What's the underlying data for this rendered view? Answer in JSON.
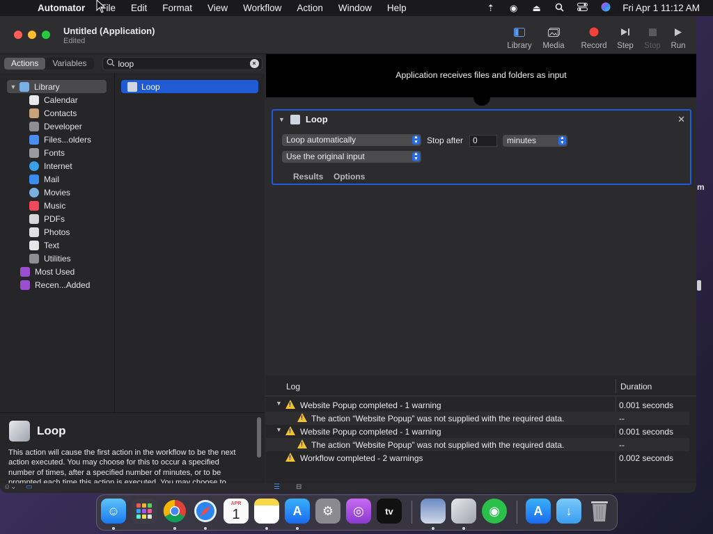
{
  "menubar": {
    "app_name": "Automator",
    "items": [
      "File",
      "Edit",
      "Format",
      "View",
      "Workflow",
      "Action",
      "Window",
      "Help"
    ],
    "clock": "Fri Apr 1  11:12 AM",
    "status_icons": [
      "wifi-icon",
      "user-icon",
      "eject-icon",
      "search-icon",
      "control-center-icon",
      "siri-icon"
    ]
  },
  "window": {
    "title": "Untitled (Application)",
    "subtitle": "Edited"
  },
  "toolbar": {
    "library": "Library",
    "media": "Media",
    "record": "Record",
    "step": "Step",
    "stop": "Stop",
    "run": "Run"
  },
  "left_tabs": {
    "actions": "Actions",
    "variables": "Variables"
  },
  "search": {
    "value": "loop"
  },
  "library": {
    "root": "Library",
    "items": [
      {
        "label": "Calendar",
        "color": "#e9e9e9"
      },
      {
        "label": "Contacts",
        "color": "#c8a27a"
      },
      {
        "label": "Developer",
        "color": "#8e8e93"
      },
      {
        "label": "Files...olders",
        "color": "#4a8df0"
      },
      {
        "label": "Fonts",
        "color": "#9a9aa0"
      },
      {
        "label": "Internet",
        "color": "#3aa0e8"
      },
      {
        "label": "Mail",
        "color": "#3a8cf0"
      },
      {
        "label": "Movies",
        "color": "#7ab0e0"
      },
      {
        "label": "Music",
        "color": "#f04a5a"
      },
      {
        "label": "PDFs",
        "color": "#d8d8d8"
      },
      {
        "label": "Photos",
        "color": "#e0e0e0"
      },
      {
        "label": "Text",
        "color": "#e6e6e6"
      },
      {
        "label": "Utilities",
        "color": "#8e8e93"
      }
    ],
    "smart_groups": [
      {
        "label": "Most Used",
        "color": "#9a4fd0"
      },
      {
        "label": "Recen...Added",
        "color": "#9a4fd0"
      }
    ]
  },
  "actions_list": {
    "items": [
      "Loop"
    ]
  },
  "description": {
    "title": "Loop",
    "text": "This action will cause the first action in the workflow to be the next action executed. You may choose for this to occur a specified number of times, after a specified number of minutes, or to be prompted each time this action is executed.  You may choose to restart the workflow with the original set of data or to"
  },
  "workflow": {
    "header": "Application receives files and folders as input",
    "card": {
      "title": "Loop",
      "loop_mode": "Loop automatically",
      "stop_after_label": "Stop after",
      "stop_after_value": "0",
      "unit": "minutes",
      "input_mode": "Use the original input",
      "tab_results": "Results",
      "tab_options": "Options"
    }
  },
  "log": {
    "col_log": "Log",
    "col_duration": "Duration",
    "rows": [
      {
        "text": "Website Popup completed - 1 warning",
        "duration": "0.001 seconds"
      },
      {
        "text": "The action “Website Popup” was not supplied with the required data.",
        "duration": "--"
      },
      {
        "text": "Website Popup completed - 1 warning",
        "duration": "0.001 seconds"
      },
      {
        "text": "The action “Website Popup” was not supplied with the required data.",
        "duration": "--"
      },
      {
        "text": "Workflow completed - 2 warnings",
        "duration": "0.002 seconds"
      }
    ]
  },
  "background": {
    "partial_text": "m"
  },
  "dock": {
    "calendar_month": "APR",
    "calendar_day": "1",
    "tv_label": "tv"
  }
}
